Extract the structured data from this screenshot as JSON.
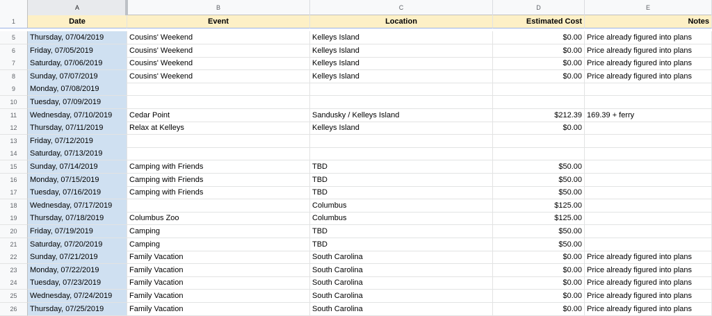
{
  "columns": [
    "A",
    "B",
    "C",
    "D",
    "E"
  ],
  "header": {
    "row_num": "1",
    "date": "Date",
    "event": "Event",
    "location": "Location",
    "cost": "Estimated Cost",
    "notes": "Notes"
  },
  "rows": [
    {
      "num": "5",
      "date": "Thursday, 07/04/2019",
      "event": "Cousins' Weekend",
      "location": "Kelleys Island",
      "cost": "$0.00",
      "notes": "Price already figured into plans"
    },
    {
      "num": "6",
      "date": "Friday, 07/05/2019",
      "event": "Cousins' Weekend",
      "location": "Kelleys Island",
      "cost": "$0.00",
      "notes": "Price already figured into plans"
    },
    {
      "num": "7",
      "date": "Saturday, 07/06/2019",
      "event": "Cousins' Weekend",
      "location": "Kelleys Island",
      "cost": "$0.00",
      "notes": "Price already figured into plans"
    },
    {
      "num": "8",
      "date": "Sunday, 07/07/2019",
      "event": "Cousins' Weekend",
      "location": "Kelleys Island",
      "cost": "$0.00",
      "notes": "Price already figured into plans"
    },
    {
      "num": "9",
      "date": "Monday, 07/08/2019",
      "event": "",
      "location": "",
      "cost": "",
      "notes": ""
    },
    {
      "num": "10",
      "date": "Tuesday, 07/09/2019",
      "event": "",
      "location": "",
      "cost": "",
      "notes": ""
    },
    {
      "num": "11",
      "date": "Wednesday, 07/10/2019",
      "event": "Cedar Point",
      "location": "Sandusky / Kelleys Island",
      "cost": "$212.39",
      "notes": "169.39 + ferry"
    },
    {
      "num": "12",
      "date": "Thursday, 07/11/2019",
      "event": "Relax at Kelleys",
      "location": "Kelleys Island",
      "cost": "$0.00",
      "notes": ""
    },
    {
      "num": "13",
      "date": "Friday, 07/12/2019",
      "event": "",
      "location": "",
      "cost": "",
      "notes": ""
    },
    {
      "num": "14",
      "date": "Saturday, 07/13/2019",
      "event": "",
      "location": "",
      "cost": "",
      "notes": ""
    },
    {
      "num": "15",
      "date": "Sunday, 07/14/2019",
      "event": "Camping with Friends",
      "location": "TBD",
      "cost": "$50.00",
      "notes": ""
    },
    {
      "num": "16",
      "date": "Monday, 07/15/2019",
      "event": "Camping with Friends",
      "location": "TBD",
      "cost": "$50.00",
      "notes": ""
    },
    {
      "num": "17",
      "date": "Tuesday, 07/16/2019",
      "event": "Camping with Friends",
      "location": "TBD",
      "cost": "$50.00",
      "notes": ""
    },
    {
      "num": "18",
      "date": "Wednesday, 07/17/2019",
      "event": "",
      "location": "Columbus",
      "cost": "$125.00",
      "notes": ""
    },
    {
      "num": "19",
      "date": "Thursday, 07/18/2019",
      "event": "Columbus Zoo",
      "location": "Columbus",
      "cost": "$125.00",
      "notes": ""
    },
    {
      "num": "20",
      "date": "Friday, 07/19/2019",
      "event": "Camping",
      "location": "TBD",
      "cost": "$50.00",
      "notes": ""
    },
    {
      "num": "21",
      "date": "Saturday, 07/20/2019",
      "event": "Camping",
      "location": "TBD",
      "cost": "$50.00",
      "notes": ""
    },
    {
      "num": "22",
      "date": "Sunday, 07/21/2019",
      "event": "Family Vacation",
      "location": "South Carolina",
      "cost": "$0.00",
      "notes": "Price already figured into plans"
    },
    {
      "num": "23",
      "date": "Monday, 07/22/2019",
      "event": "Family Vacation",
      "location": "South Carolina",
      "cost": "$0.00",
      "notes": "Price already figured into plans"
    },
    {
      "num": "24",
      "date": "Tuesday, 07/23/2019",
      "event": "Family Vacation",
      "location": "South Carolina",
      "cost": "$0.00",
      "notes": "Price already figured into plans"
    },
    {
      "num": "25",
      "date": "Wednesday, 07/24/2019",
      "event": "Family Vacation",
      "location": "South Carolina",
      "cost": "$0.00",
      "notes": "Price already figured into plans"
    },
    {
      "num": "26",
      "date": "Thursday, 07/25/2019",
      "event": "Family Vacation",
      "location": "South Carolina",
      "cost": "$0.00",
      "notes": "Price already figured into plans"
    }
  ],
  "colors": {
    "header_fill": "#fdf0c6",
    "date_fill": "#cfe0f1",
    "gridline": "#e2e3e3"
  }
}
